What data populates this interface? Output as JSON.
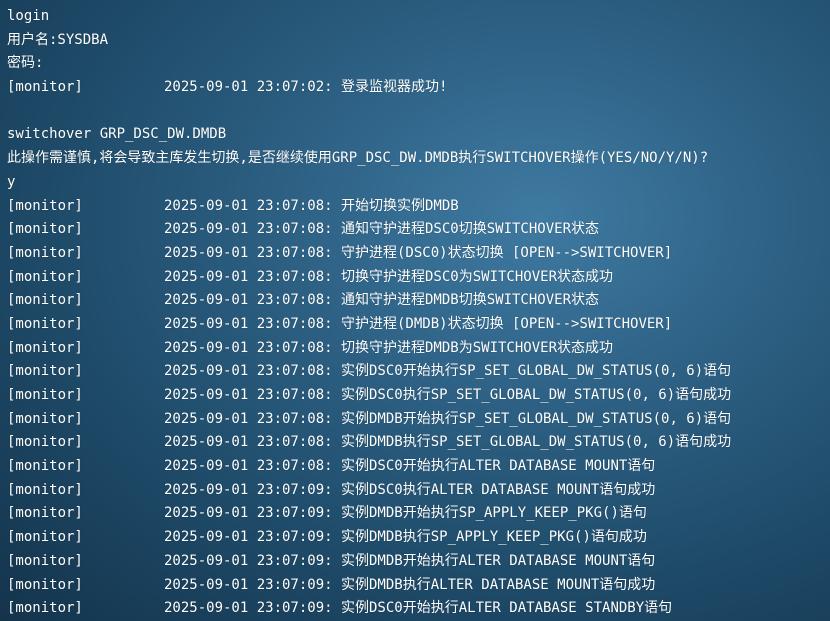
{
  "terminal": {
    "login_cmd": "login",
    "username_line": "用户名:SYSDBA",
    "password_line": "密码:",
    "login_log": {
      "tag": "[monitor]",
      "ts": "2025-09-01 23:07:02:",
      "msg": " 登录监视器成功!"
    },
    "switchover_cmd": "switchover GRP_DSC_DW.DMDB",
    "confirm_prompt": "此操作需谨慎,将会导致主库发生切换,是否继续使用GRP_DSC_DW.DMDB执行SWITCHOVER操作(YES/NO/Y/N)?",
    "confirm_answer": "y",
    "logs": [
      {
        "tag": "[monitor]",
        "ts": "2025-09-01 23:07:08:",
        "msg": " 开始切换实例DMDB"
      },
      {
        "tag": "[monitor]",
        "ts": "2025-09-01 23:07:08:",
        "msg": " 通知守护进程DSC0切换SWITCHOVER状态"
      },
      {
        "tag": "[monitor]",
        "ts": "2025-09-01 23:07:08:",
        "msg": " 守护进程(DSC0)状态切换 [OPEN-->SWITCHOVER]"
      },
      {
        "tag": "[monitor]",
        "ts": "2025-09-01 23:07:08:",
        "msg": " 切换守护进程DSC0为SWITCHOVER状态成功"
      },
      {
        "tag": "[monitor]",
        "ts": "2025-09-01 23:07:08:",
        "msg": " 通知守护进程DMDB切换SWITCHOVER状态"
      },
      {
        "tag": "[monitor]",
        "ts": "2025-09-01 23:07:08:",
        "msg": " 守护进程(DMDB)状态切换 [OPEN-->SWITCHOVER]"
      },
      {
        "tag": "[monitor]",
        "ts": "2025-09-01 23:07:08:",
        "msg": " 切换守护进程DMDB为SWITCHOVER状态成功"
      },
      {
        "tag": "[monitor]",
        "ts": "2025-09-01 23:07:08:",
        "msg": " 实例DSC0开始执行SP_SET_GLOBAL_DW_STATUS(0, 6)语句"
      },
      {
        "tag": "[monitor]",
        "ts": "2025-09-01 23:07:08:",
        "msg": " 实例DSC0执行SP_SET_GLOBAL_DW_STATUS(0, 6)语句成功"
      },
      {
        "tag": "[monitor]",
        "ts": "2025-09-01 23:07:08:",
        "msg": " 实例DMDB开始执行SP_SET_GLOBAL_DW_STATUS(0, 6)语句"
      },
      {
        "tag": "[monitor]",
        "ts": "2025-09-01 23:07:08:",
        "msg": " 实例DMDB执行SP_SET_GLOBAL_DW_STATUS(0, 6)语句成功"
      },
      {
        "tag": "[monitor]",
        "ts": "2025-09-01 23:07:08:",
        "msg": " 实例DSC0开始执行ALTER DATABASE MOUNT语句"
      },
      {
        "tag": "[monitor]",
        "ts": "2025-09-01 23:07:09:",
        "msg": " 实例DSC0执行ALTER DATABASE MOUNT语句成功"
      },
      {
        "tag": "[monitor]",
        "ts": "2025-09-01 23:07:09:",
        "msg": " 实例DMDB开始执行SP_APPLY_KEEP_PKG()语句"
      },
      {
        "tag": "[monitor]",
        "ts": "2025-09-01 23:07:09:",
        "msg": " 实例DMDB执行SP_APPLY_KEEP_PKG()语句成功"
      },
      {
        "tag": "[monitor]",
        "ts": "2025-09-01 23:07:09:",
        "msg": " 实例DMDB开始执行ALTER DATABASE MOUNT语句"
      },
      {
        "tag": "[monitor]",
        "ts": "2025-09-01 23:07:09:",
        "msg": " 实例DMDB执行ALTER DATABASE MOUNT语句成功"
      },
      {
        "tag": "[monitor]",
        "ts": "2025-09-01 23:07:09:",
        "msg": " 实例DSC0开始执行ALTER DATABASE STANDBY语句"
      }
    ]
  }
}
